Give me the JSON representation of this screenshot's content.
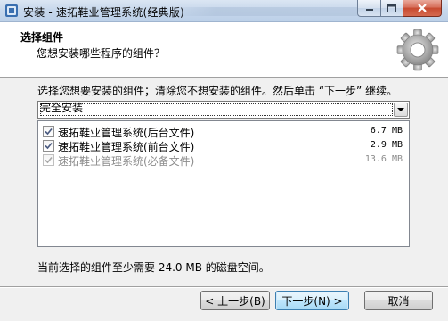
{
  "window": {
    "title": "安装 - 速拓鞋业管理系统(经典版)",
    "controls": {
      "minimize": "minimize-icon",
      "maximize": "maximize-icon",
      "close": "close-icon"
    }
  },
  "header": {
    "title": "选择组件",
    "subtitle": "您想安装哪些程序的组件？",
    "icon": "gear-icon"
  },
  "main": {
    "instruction": "选择您想要安装的组件；清除您不想安装的组件。然后单击 “下一步” 继续。",
    "install_type": {
      "selected": "完全安装"
    },
    "components": [
      {
        "label": "速拓鞋业管理系统(后台文件)",
        "size": "6.7 MB",
        "checked": true,
        "disabled": false
      },
      {
        "label": "速拓鞋业管理系统(前台文件)",
        "size": "2.9 MB",
        "checked": true,
        "disabled": false
      },
      {
        "label": "速拓鞋业管理系统(必备文件)",
        "size": "13.6 MB",
        "checked": true,
        "disabled": true
      }
    ],
    "space_required": "当前选择的组件至少需要 24.0 MB 的磁盘空间。"
  },
  "footer": {
    "back_label": "< 上一步(B)",
    "next_label": "下一步(N) >",
    "cancel_label": "取消"
  },
  "colors": {
    "content_bg": "#f0f0f0",
    "default_button_border": "#3c7fb1",
    "disabled_text": "#8c8c8c"
  }
}
